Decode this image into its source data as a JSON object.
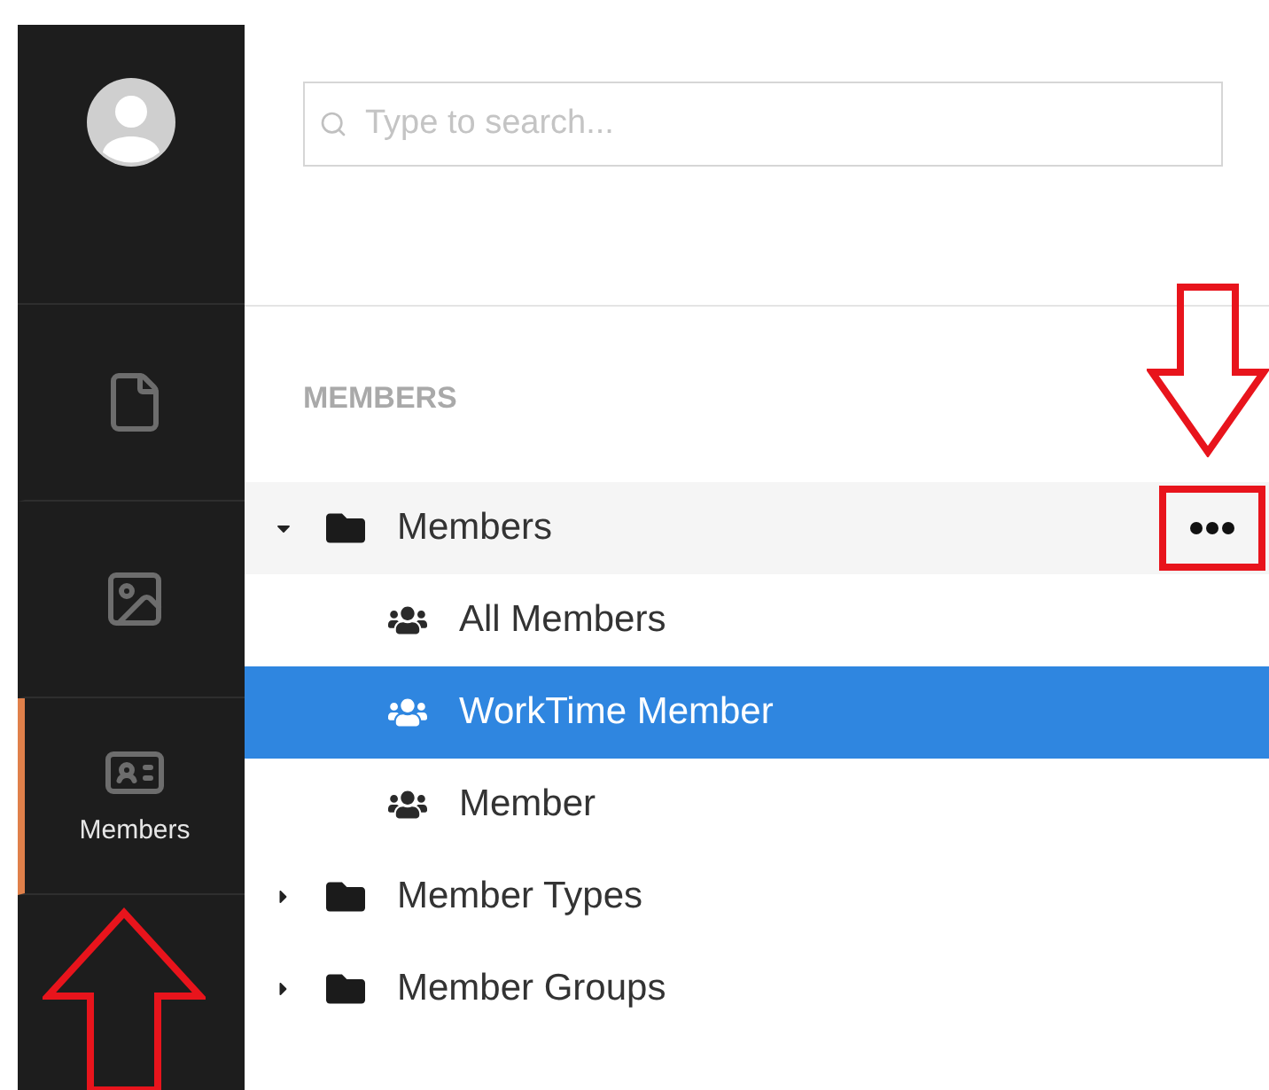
{
  "sidebar": {
    "items": [
      {
        "kind": "content",
        "selected": false
      },
      {
        "kind": "media",
        "selected": false
      },
      {
        "kind": "members",
        "label": "Members",
        "selected": true
      }
    ]
  },
  "search": {
    "placeholder": "Type to search..."
  },
  "tree": {
    "heading": "MEMBERS",
    "items": [
      {
        "kind": "folder",
        "label": "Members",
        "expanded": true,
        "hovered": true,
        "selected": false,
        "children": [
          {
            "kind": "member-type",
            "label": "All Members",
            "selected": false
          },
          {
            "kind": "member-type",
            "label": "WorkTime Member",
            "selected": true
          },
          {
            "kind": "member-type",
            "label": "Member",
            "selected": false
          }
        ]
      },
      {
        "kind": "folder",
        "label": "Member Types",
        "expanded": false,
        "hovered": false,
        "selected": false
      },
      {
        "kind": "folder",
        "label": "Member Groups",
        "expanded": false,
        "hovered": false,
        "selected": false
      }
    ]
  }
}
